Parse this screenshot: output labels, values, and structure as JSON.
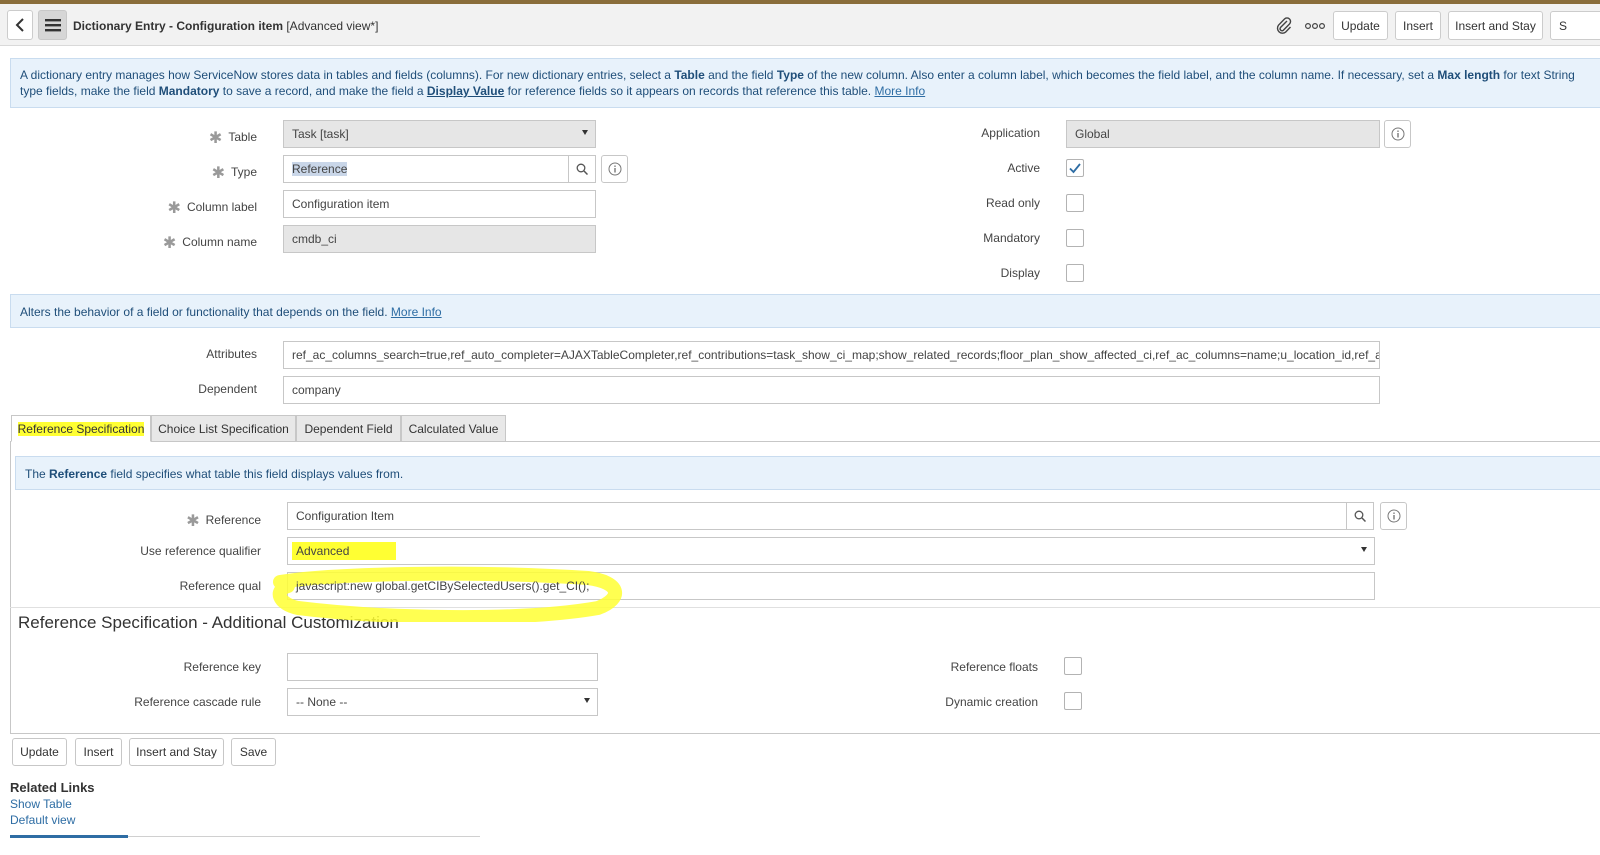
{
  "header": {
    "title_bold": "Dictionary Entry - Configuration item",
    "title_suffix": " [Advanced view*]",
    "buttons": [
      "Update",
      "Insert",
      "Insert and Stay",
      "S"
    ]
  },
  "info1": {
    "p1": "A dictionary entry manages how ServiceNow stores data in tables and fields (columns). For new dictionary entries, select a ",
    "b1": "Table",
    "p2": " and the field ",
    "b2": "Type",
    "p3": " of the new column. Also enter a column label, which becomes the field label, and the column name. If necessary, set a ",
    "b3": "Max length",
    "p4": " for text String type fields, make the field ",
    "b4": "Mandatory",
    "p5": " to save a record, and make the field a ",
    "b5": "Display Value",
    "p6": " for reference fields so it appears on records that reference this table. ",
    "more": "More Info"
  },
  "form": {
    "table_label": "Table",
    "table_value": "Task [task]",
    "type_label": "Type",
    "type_value": "Reference",
    "column_label_label": "Column label",
    "column_label_value": "Configuration item",
    "column_name_label": "Column name",
    "column_name_value": "cmdb_ci",
    "application_label": "Application",
    "application_value": "Global",
    "active_label": "Active",
    "active_checked": true,
    "read_only_label": "Read only",
    "mandatory_label": "Mandatory",
    "display_label": "Display"
  },
  "info2": {
    "text": "Alters the behavior of a field or functionality that depends on the field. ",
    "more": "More Info"
  },
  "attributes": {
    "attributes_label": "Attributes",
    "attributes_value": "ref_ac_columns_search=true,ref_auto_completer=AJAXTableCompleter,ref_contributions=task_show_ci_map;show_related_records;floor_plan_show_affected_ci,ref_ac_columns=name;u_location_id,ref_ac",
    "dependent_label": "Dependent",
    "dependent_value": "company"
  },
  "tabs": [
    "Reference Specification",
    "Choice List Specification",
    "Dependent Field",
    "Calculated Value"
  ],
  "info3": {
    "p1": "The ",
    "b1": "Reference",
    "p2": " field specifies what table this field displays values from."
  },
  "refspec": {
    "reference_label": "Reference",
    "reference_value": "Configuration Item",
    "qualifier_label": "Use reference qualifier",
    "qualifier_value": "Advanced",
    "qual_label": "Reference qual",
    "qual_value": "javascript:new global.getCIBySelectedUsers().get_CI();"
  },
  "additional": {
    "heading": "Reference Specification - Additional Customization",
    "ref_key_label": "Reference key",
    "ref_key_value": "",
    "cascade_label": "Reference cascade rule",
    "cascade_value": "-- None --",
    "floats_label": "Reference floats",
    "dynamic_label": "Dynamic creation"
  },
  "bottom_buttons": [
    "Update",
    "Insert",
    "Insert and Stay",
    "Save"
  ],
  "related": {
    "heading": "Related Links",
    "links": [
      "Show Table",
      "Default view"
    ]
  }
}
